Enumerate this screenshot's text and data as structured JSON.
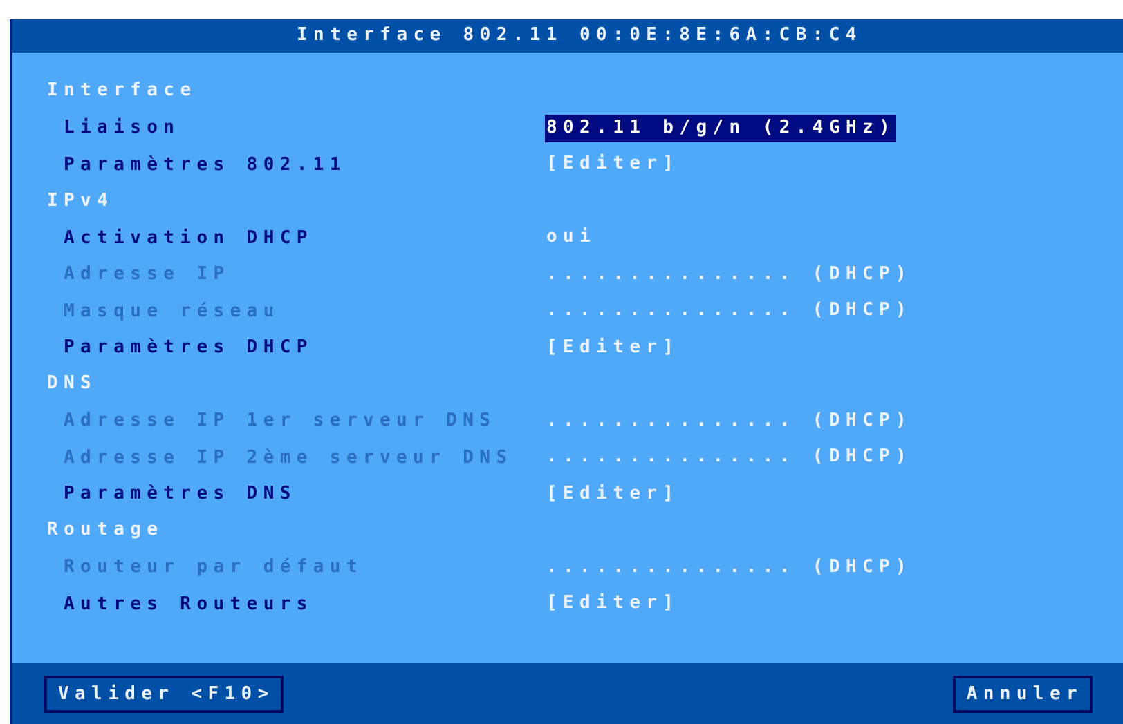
{
  "window": {
    "title": "Interface 802.11 00:0E:8E:6A:CB:C4"
  },
  "sections": [
    {
      "title": "Interface",
      "items": [
        {
          "label": "Liaison",
          "disabled": false,
          "value": "802.11 b/g/n (2.4GHz)",
          "selected": true
        },
        {
          "label": "Paramètres 802.11",
          "disabled": false,
          "value": "[Editer]",
          "selected": false
        }
      ]
    },
    {
      "title": "IPv4",
      "items": [
        {
          "label": "Activation DHCP",
          "disabled": false,
          "value": "oui",
          "selected": false
        },
        {
          "label": "Adresse IP",
          "disabled": true,
          "value": "............... (DHCP)",
          "selected": false
        },
        {
          "label": "Masque réseau",
          "disabled": true,
          "value": "............... (DHCP)",
          "selected": false
        },
        {
          "label": "Paramètres DHCP",
          "disabled": false,
          "value": "[Editer]",
          "selected": false
        }
      ]
    },
    {
      "title": "DNS",
      "items": [
        {
          "label": "Adresse IP 1er serveur DNS",
          "disabled": true,
          "value": "............... (DHCP)",
          "selected": false
        },
        {
          "label": "Adresse IP 2ème serveur DNS",
          "disabled": true,
          "value": "............... (DHCP)",
          "selected": false
        },
        {
          "label": "Paramètres DNS",
          "disabled": false,
          "value": "[Editer]",
          "selected": false
        }
      ]
    },
    {
      "title": "Routage",
      "items": [
        {
          "label": "Routeur par défaut",
          "disabled": true,
          "value": "............... (DHCP)",
          "selected": false
        },
        {
          "label": "Autres Routeurs",
          "disabled": false,
          "value": "[Editer]",
          "selected": false
        }
      ]
    }
  ],
  "buttons": [
    {
      "label": "Valider <F10>"
    },
    {
      "label": "Annuler"
    }
  ]
}
